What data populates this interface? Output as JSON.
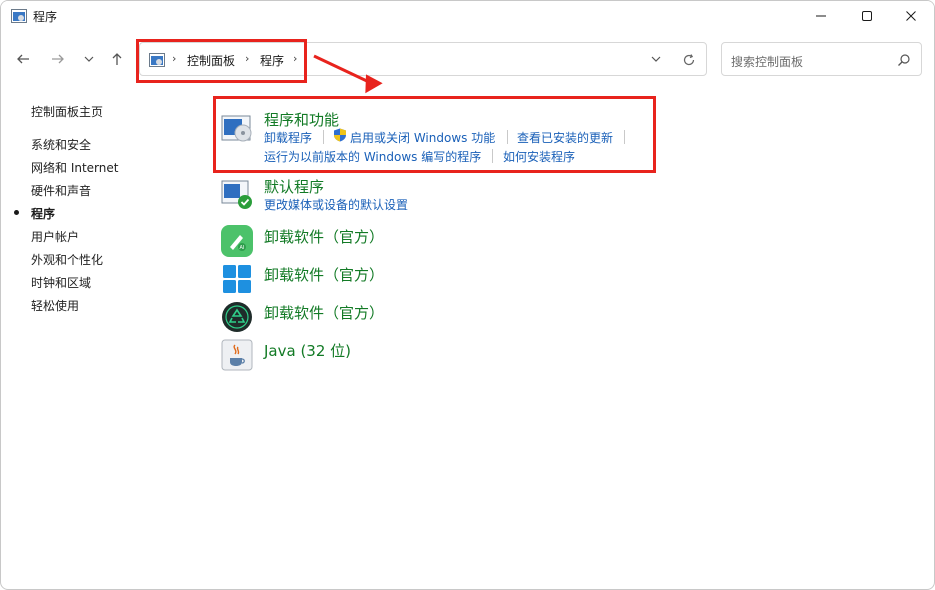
{
  "window": {
    "title": "程序"
  },
  "address_bar": {
    "crumbs": [
      "控制面板",
      "程序"
    ]
  },
  "search": {
    "placeholder": "搜索控制面板"
  },
  "sidebar": {
    "home": "控制面板主页",
    "items": [
      "系统和安全",
      "网络和 Internet",
      "硬件和声音",
      "程序",
      "用户帐户",
      "外观和个性化",
      "时钟和区域",
      "轻松使用"
    ],
    "active_index": 3
  },
  "sections": {
    "programs_features": {
      "title": "程序和功能",
      "links": [
        "卸载程序",
        "启用或关闭 Windows 功能",
        "查看已安装的更新",
        "运行为以前版本的 Windows 编写的程序",
        "如何安装程序"
      ]
    },
    "default_programs": {
      "title": "默认程序",
      "links": [
        "更改媒体或设备的默认设置"
      ]
    },
    "uninstall_1": {
      "title": "卸载软件（官方）"
    },
    "uninstall_2": {
      "title": "卸载软件（官方）"
    },
    "uninstall_3": {
      "title": "卸载软件（官方）"
    },
    "java": {
      "title": "Java (32 位)"
    }
  },
  "colors": {
    "highlight": "#e8231d",
    "link": "#1a60b8",
    "title_green": "#127a25"
  }
}
